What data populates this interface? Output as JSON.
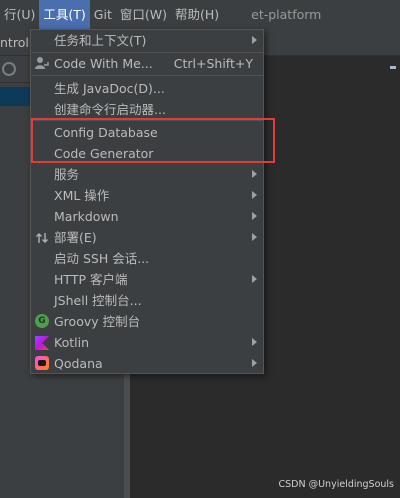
{
  "menubar": {
    "items": [
      "行(U)",
      "工具(T)",
      "Git",
      "窗口(W)",
      "帮助(H)"
    ],
    "project_title": "et-platform"
  },
  "left_panel": {
    "breadcrumb": "ntrolle"
  },
  "tools_menu": {
    "items": [
      {
        "label": "任务和上下文(T)",
        "submenu": true
      },
      {
        "label": "Code With Me...",
        "shortcut": "Ctrl+Shift+Y",
        "icon": "user-icon"
      },
      {
        "label": "生成 JavaDoc(D)..."
      },
      {
        "label": "创建命令行启动器..."
      },
      {
        "label": "Config Database"
      },
      {
        "label": "Code Generator"
      },
      {
        "label": "服务",
        "submenu": true
      },
      {
        "label": "XML 操作",
        "submenu": true
      },
      {
        "label": "Markdown",
        "submenu": true
      },
      {
        "label": "部署(E)",
        "submenu": true,
        "icon": "deploy-arrows-icon"
      },
      {
        "label": "启动 SSH 会话..."
      },
      {
        "label": "HTTP 客户端",
        "submenu": true
      },
      {
        "label": "JShell 控制台..."
      },
      {
        "label": "Groovy 控制台",
        "icon": "groovy-icon"
      },
      {
        "label": "Kotlin",
        "submenu": true,
        "icon": "kotlin-icon"
      },
      {
        "label": "Qodana",
        "submenu": true,
        "icon": "qodana-icon"
      }
    ]
  },
  "watermark": "CSDN @UnyieldingSouls",
  "colors": {
    "menu_bg": "#3c3f41",
    "active_menu": "#4b6eaf",
    "highlight_box": "#e23b3b",
    "editor_bg": "#2b2b2b"
  }
}
